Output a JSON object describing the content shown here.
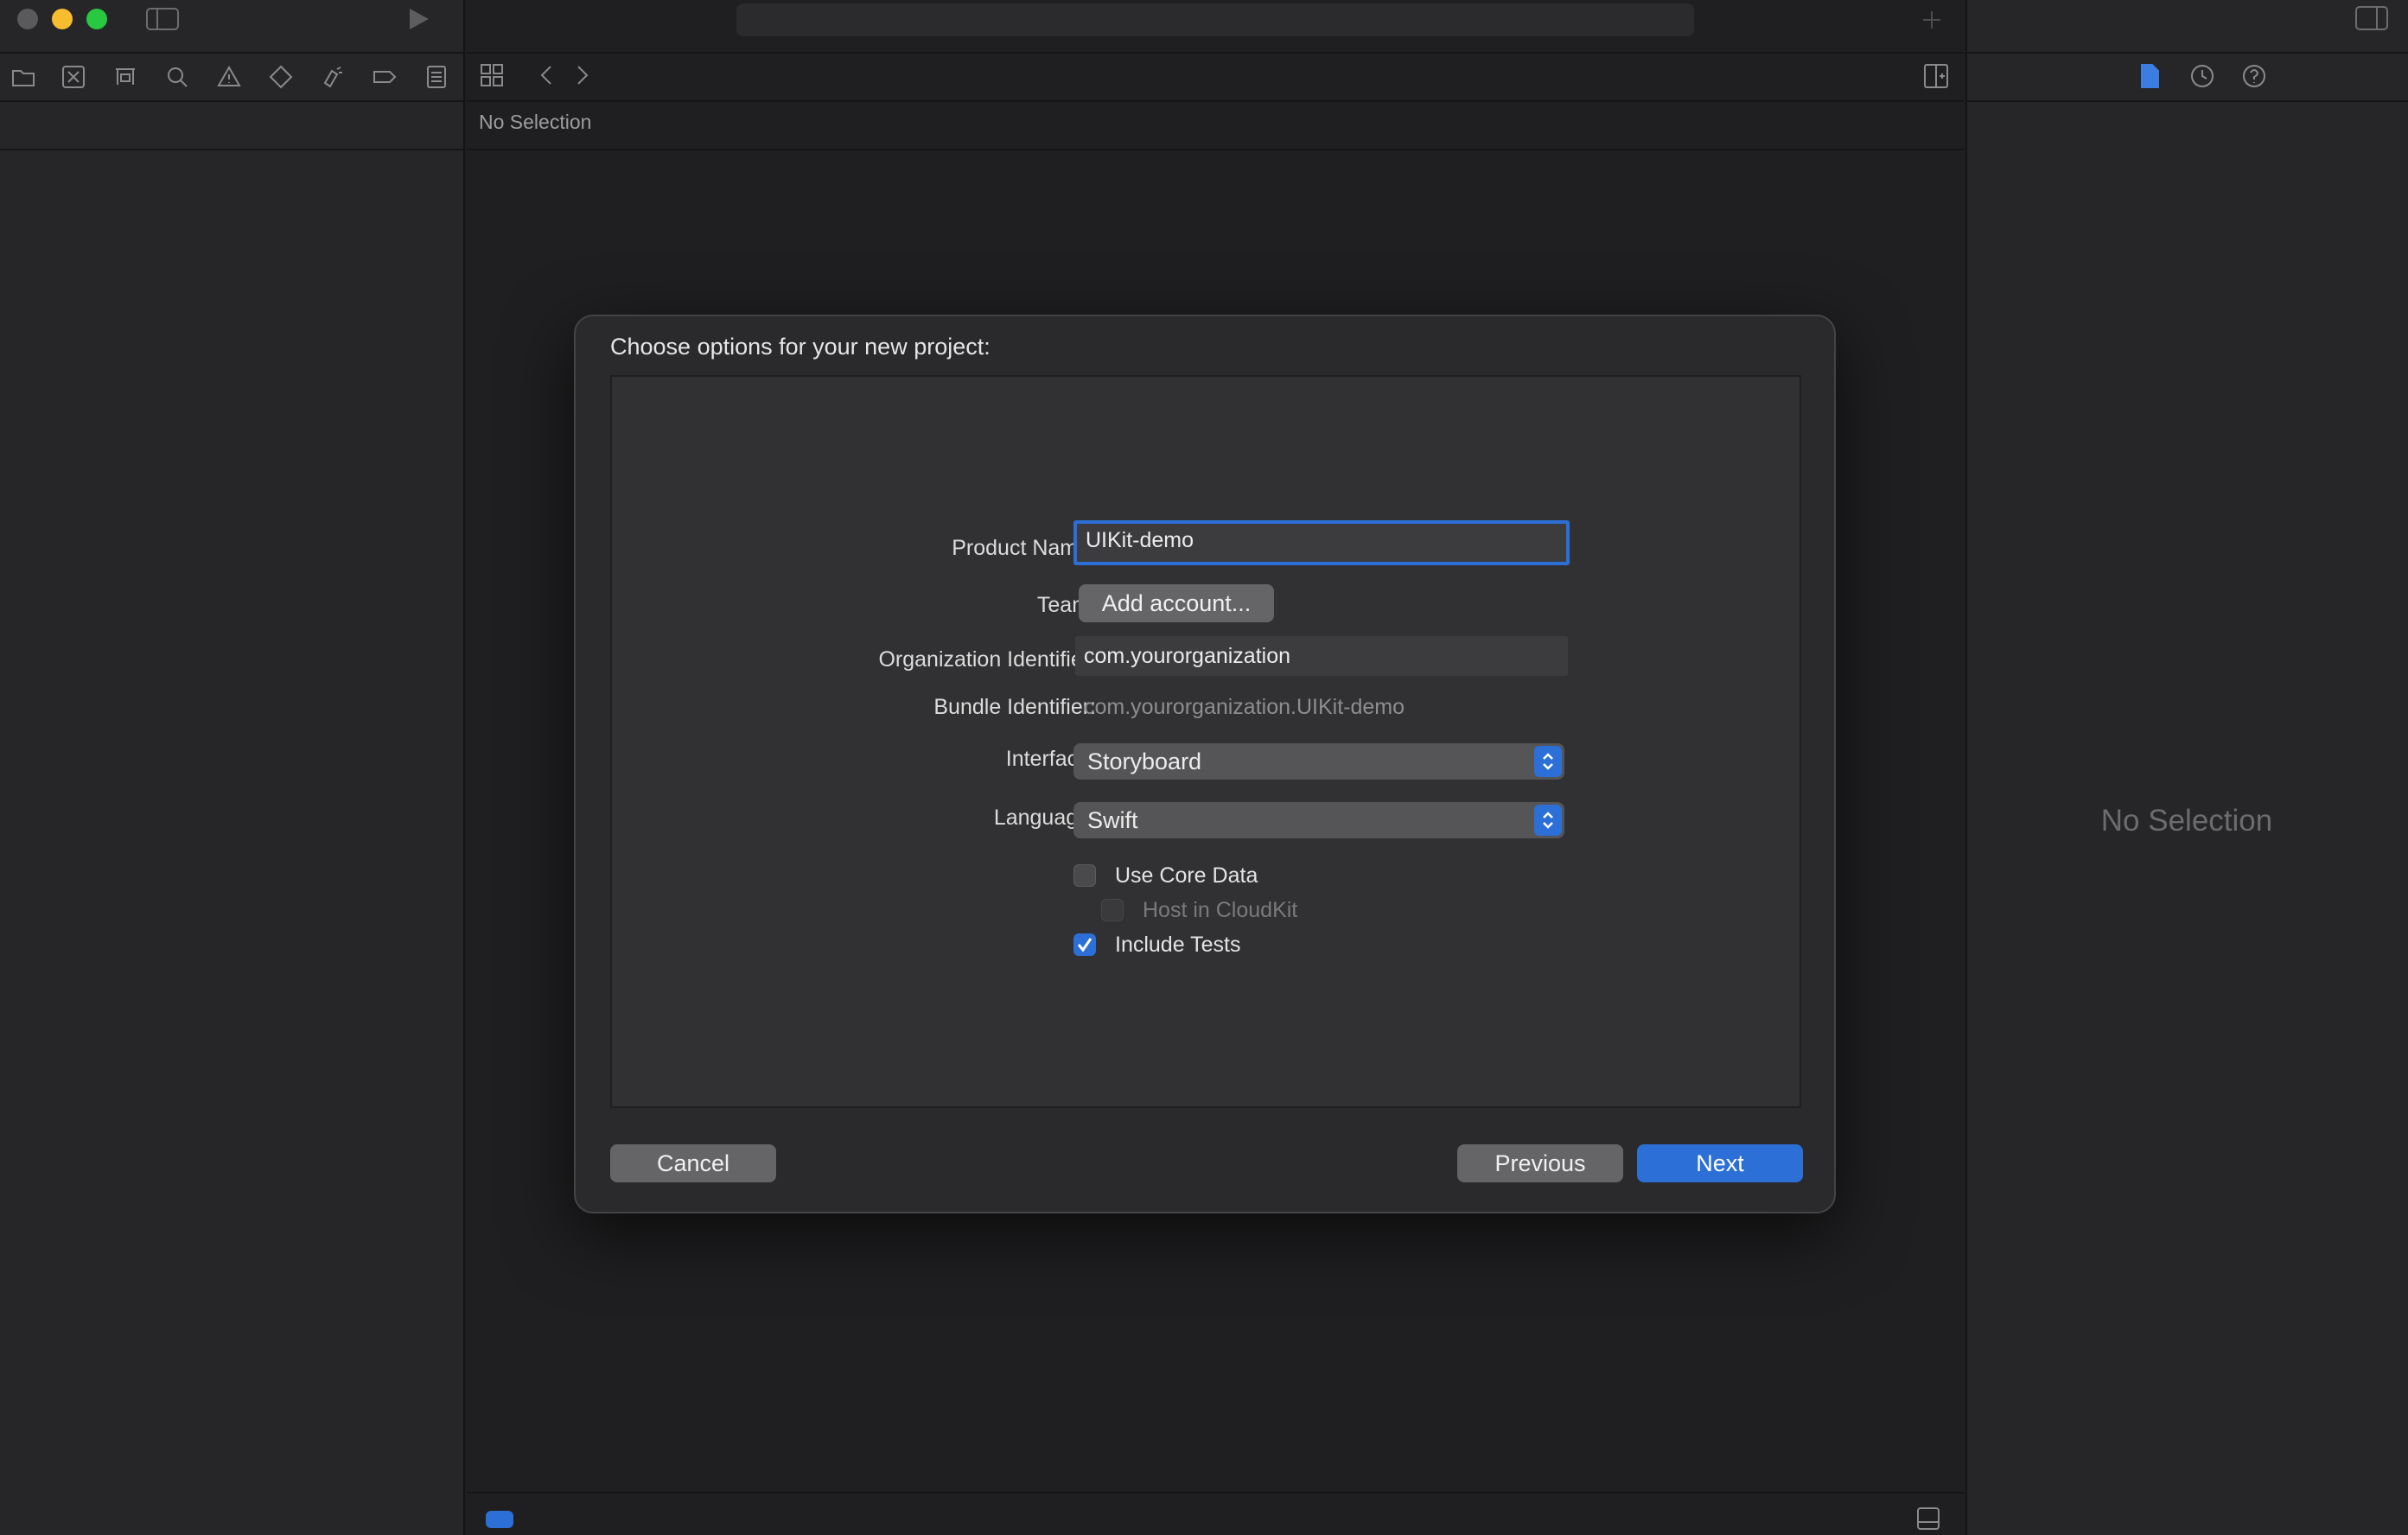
{
  "window": {
    "traffic_lights": {
      "close": "#5a5a5c",
      "minimize": "#f5bd2f",
      "zoom": "#28c840"
    }
  },
  "navigator": {
    "icons": [
      "folder-icon",
      "source-control-icon",
      "symbol-icon",
      "search-icon",
      "warning-icon",
      "test-icon",
      "debug-icon",
      "breakpoint-icon",
      "report-icon"
    ]
  },
  "editor": {
    "path_label": "No Selection"
  },
  "inspector": {
    "empty_label": "No Selection",
    "icons": [
      "file-inspector-icon",
      "history-icon",
      "help-icon"
    ],
    "accent": "#3b7de0"
  },
  "dialog": {
    "title": "Choose options for your new project:",
    "product_name_label": "Product Name:",
    "product_name_value": "UIKit-demo",
    "team_label": "Team:",
    "team_button": "Add account...",
    "org_id_label": "Organization Identifier:",
    "org_id_value": "com.yourorganization",
    "bundle_id_label": "Bundle Identifier:",
    "bundle_id_value": "com.yourorganization.UIKit-demo",
    "interface_label": "Interface:",
    "interface_value": "Storyboard",
    "language_label": "Language:",
    "language_value": "Swift",
    "use_core_data_label": "Use Core Data",
    "use_core_data_checked": false,
    "host_cloudkit_label": "Host in CloudKit",
    "host_cloudkit_checked": false,
    "include_tests_label": "Include Tests",
    "include_tests_checked": true,
    "cancel_button": "Cancel",
    "previous_button": "Previous",
    "next_button": "Next"
  },
  "colors": {
    "accent": "#2c6fd6",
    "background": "#1e1e1e",
    "dialog": "#2a2a2d"
  }
}
